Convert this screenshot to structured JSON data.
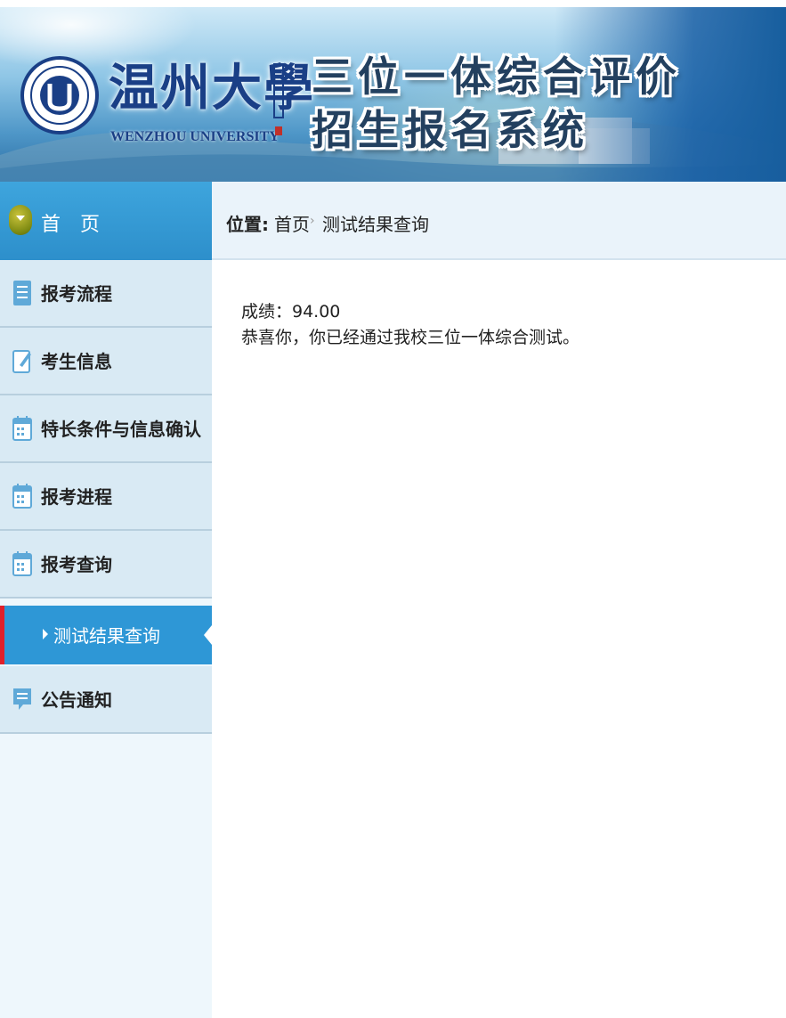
{
  "banner": {
    "school_name": "温州大學",
    "school_name_en": "WENZHOU UNIVERSITY",
    "system_title_line1": "三位一体综合评价",
    "system_title_line2": "招生报名系统"
  },
  "sidebar": {
    "home": "首页",
    "items": [
      {
        "label": "报考流程",
        "icon": "list-icon"
      },
      {
        "label": "考生信息",
        "icon": "edit-icon"
      },
      {
        "label": "特长条件与信息确认",
        "icon": "calendar-icon"
      },
      {
        "label": "报考进程",
        "icon": "calendar-icon"
      },
      {
        "label": "报考查询",
        "icon": "calendar-icon"
      },
      {
        "label": "公告通知",
        "icon": "message-icon"
      }
    ],
    "sub_item": {
      "label": "测试结果查询",
      "active": true
    }
  },
  "breadcrumb": {
    "label": "位置:",
    "home": "首页",
    "separator": "›",
    "current": "测试结果查询"
  },
  "result": {
    "score_text": "成绩：94.00",
    "message": "恭喜你，你已经通过我校三位一体综合测试。"
  },
  "colors": {
    "sidebar_active": "#2e97d6",
    "sidebar_item": "#d9eaf4",
    "active_marker": "#e0202a"
  }
}
